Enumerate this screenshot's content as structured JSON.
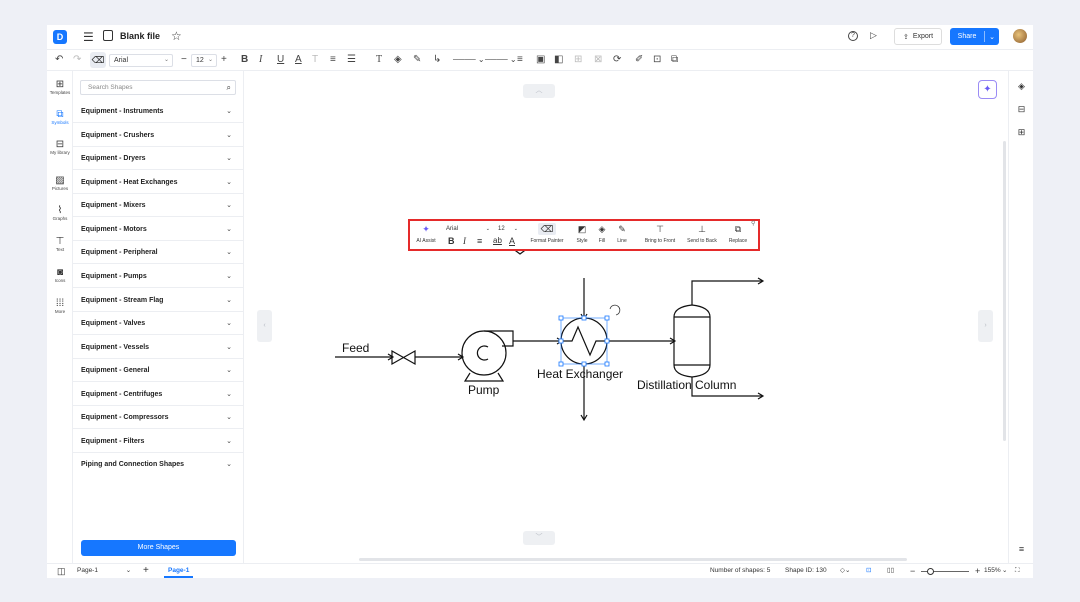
{
  "topbar": {
    "logo": "D",
    "file_name": "Blank file",
    "export_label": "Export",
    "share_label": "Share"
  },
  "toolbar": {
    "font": "Arial",
    "font_size": "12"
  },
  "left_rail": [
    {
      "label": "Templates",
      "icon": "templates-icon"
    },
    {
      "label": "Symbols",
      "icon": "symbols-icon"
    },
    {
      "label": "My library",
      "icon": "library-icon"
    },
    {
      "label": "Pictures",
      "icon": "pictures-icon"
    },
    {
      "label": "Graphs",
      "icon": "graphs-icon"
    },
    {
      "label": "Text",
      "icon": "text-icon"
    },
    {
      "label": "Icons",
      "icon": "icons-icon"
    },
    {
      "label": "More",
      "icon": "more-icon"
    }
  ],
  "shapes_panel": {
    "search_placeholder": "Search Shapes",
    "categories": [
      "Equipment - Instruments",
      "Equipment - Crushers",
      "Equipment - Dryers",
      "Equipment - Heat Exchanges",
      "Equipment - Mixers",
      "Equipment - Motors",
      "Equipment - Peripheral",
      "Equipment - Pumps",
      "Equipment - Stream Flag",
      "Equipment - Valves",
      "Equipment - Vessels",
      "Equipment - General",
      "Equipment - Centrifuges",
      "Equipment - Compressors",
      "Equipment - Filters",
      "Piping and Connection Shapes"
    ],
    "more_shapes_label": "More Shapes"
  },
  "floating_toolbar": {
    "ai_assist": "AI Assist",
    "font": "Arial",
    "font_size": "12",
    "format_painter": "Format Painter",
    "style": "Style",
    "fill": "Fill",
    "line": "Line",
    "bring_to_front": "Bring to Front",
    "send_to_back": "Send to Back",
    "replace": "Replace"
  },
  "diagram": {
    "feed_label": "Feed",
    "pump_label": "Pump",
    "heat_exchanger_label": "Heat Exchanger",
    "distillation_label": "Distillation Column"
  },
  "statusbar": {
    "page_select": "Page-1",
    "page_tab": "Page-1",
    "shape_count": "Number of shapes: 5",
    "shape_id": "Shape ID: 130",
    "zoom": "155%"
  },
  "colors": {
    "accent": "#1677ff",
    "highlight": "#e52a2a",
    "ai": "#6a5cf5"
  }
}
